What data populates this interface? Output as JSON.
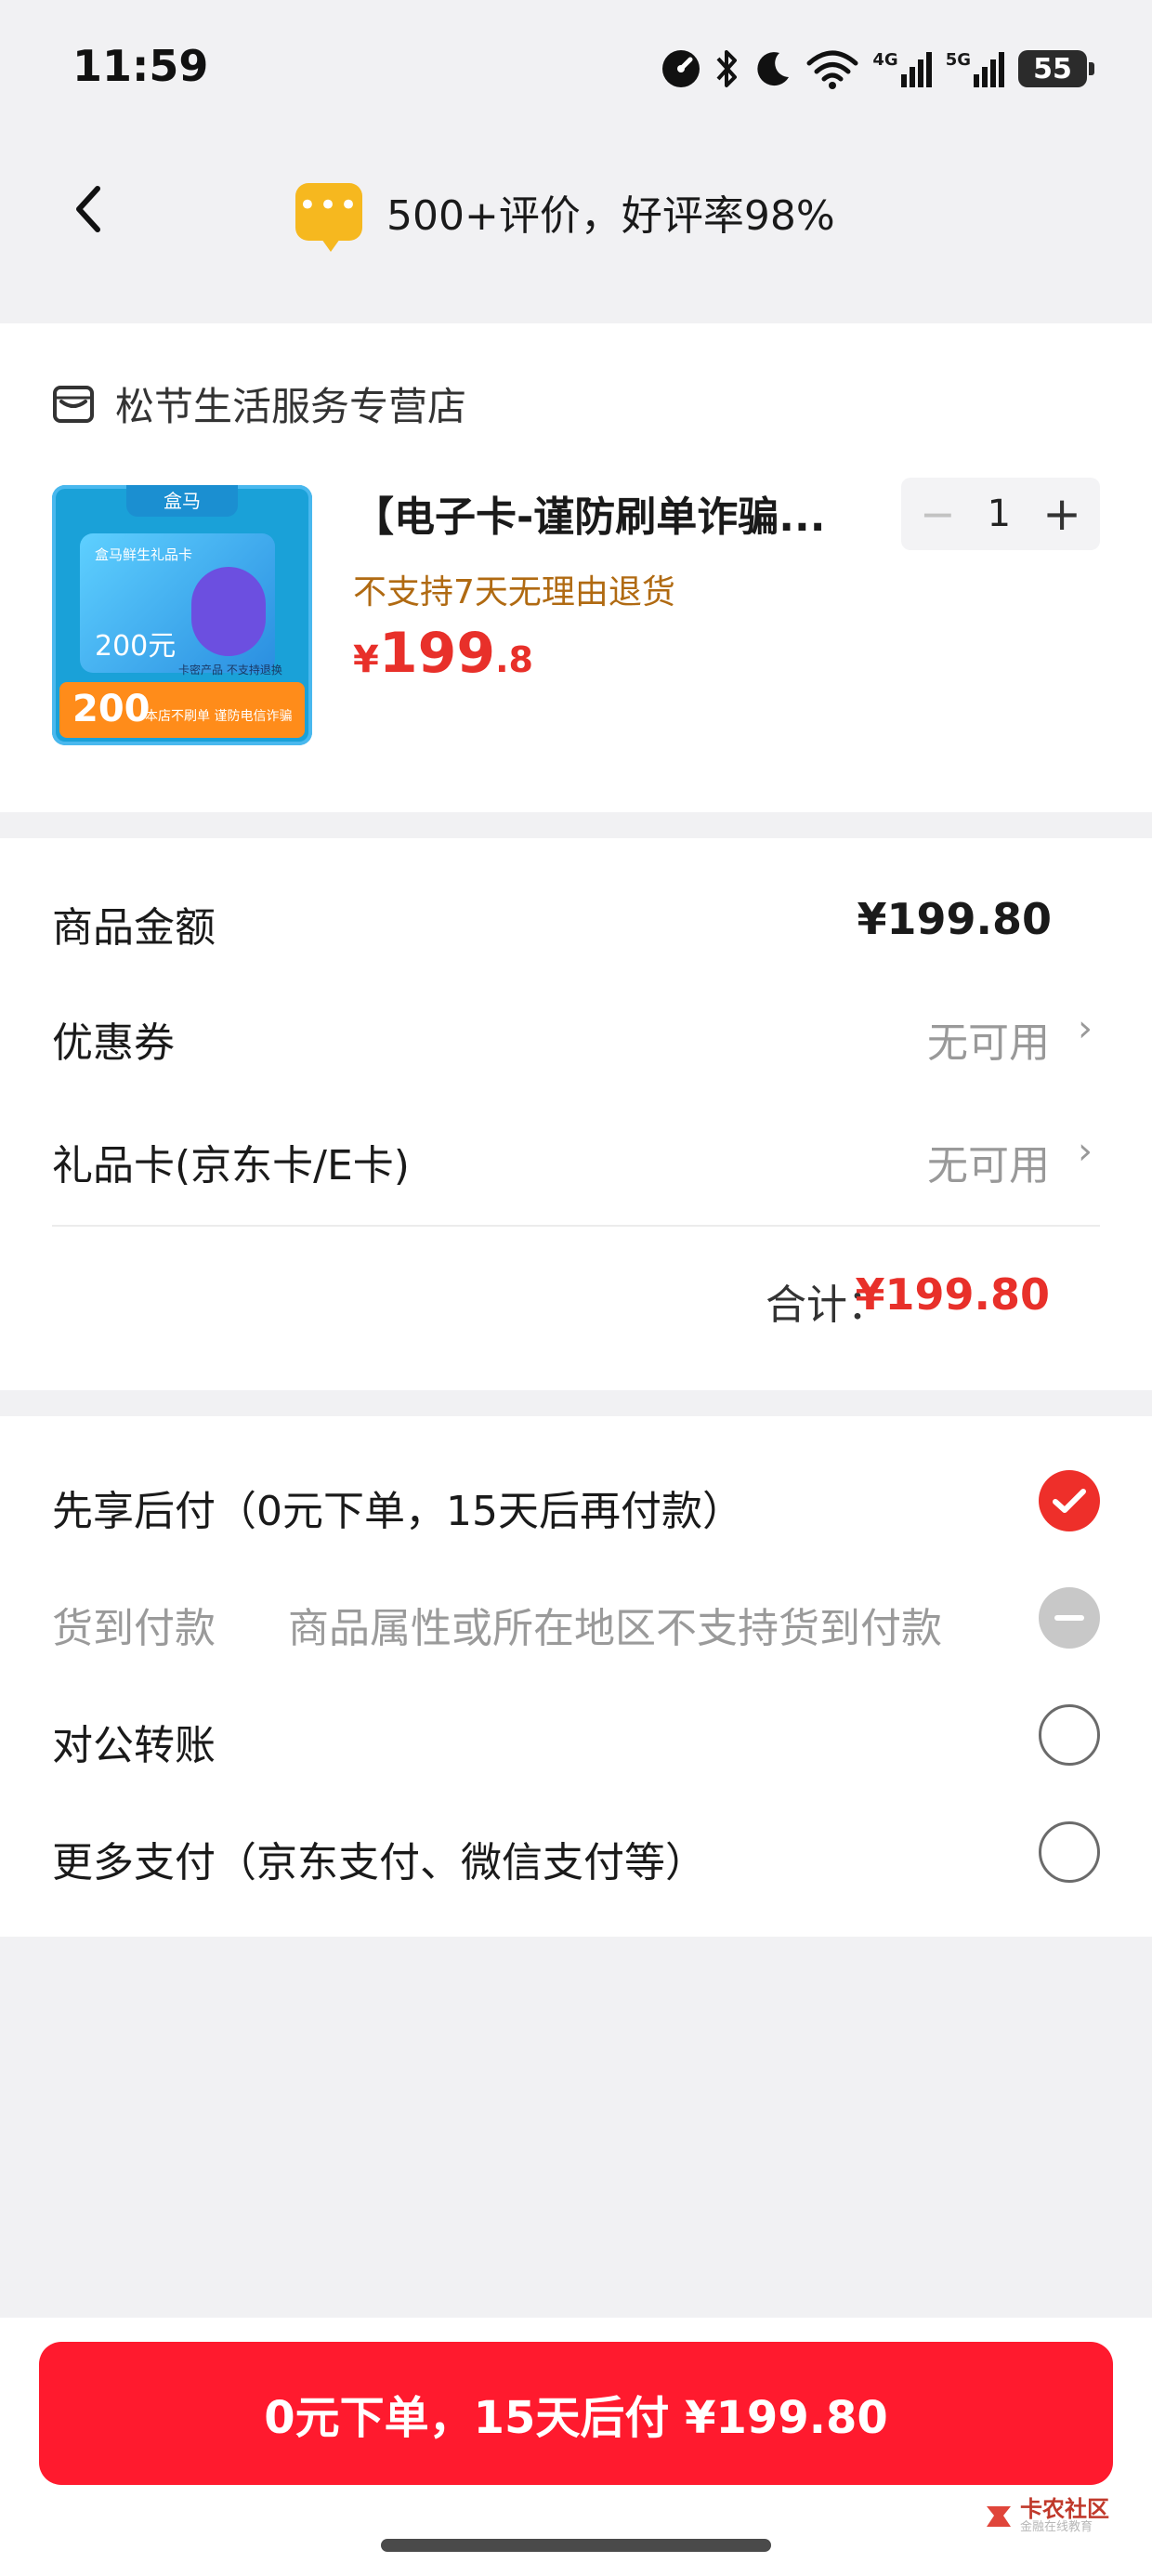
{
  "status_bar": {
    "time": "11:59",
    "network_4g": "4G",
    "network_5g": "5G",
    "battery": "55"
  },
  "header": {
    "reviews_text": "500+评价，好评率98%"
  },
  "store": {
    "name": "松节生活服务专营店"
  },
  "product": {
    "title": "【电子卡-谨防刷单诈骗...",
    "return_note": "不支持7天无理由退货",
    "price_symbol": "¥",
    "price_int": "199",
    "price_dec": ".8",
    "quantity": "1",
    "thumbnail": {
      "brand": "盒马",
      "card_title": "盒马鲜生礼品卡",
      "card_value": "200元",
      "band_number": "200",
      "band_top_text": "卡密产品 不支持退换",
      "band_text": "本店不刷单 谨防电信诈骗"
    }
  },
  "summary": {
    "goods_amount_label": "商品金额",
    "goods_amount_value": "¥199.80",
    "coupon_label": "优惠券",
    "coupon_value": "无可用",
    "giftcard_label": "礼品卡(京东卡/E卡)",
    "giftcard_value": "无可用",
    "total_label": "合计：",
    "total_value": "¥199.80"
  },
  "payment": {
    "options": [
      {
        "label": "先享后付（0元下单，15天后再付款）",
        "state": "checked"
      },
      {
        "label": "货到付款",
        "note": "商品属性或所在地区不支持货到付款",
        "state": "disabled"
      },
      {
        "label": "对公转账",
        "state": "unchecked"
      },
      {
        "label": "更多支付（京东支付、微信支付等）",
        "state": "unchecked"
      }
    ]
  },
  "submit": {
    "label": "0元下单，15天后付 ¥199.80"
  },
  "watermark": {
    "title": "卡农社区",
    "subtitle": "金融在线教育"
  },
  "colors": {
    "accent_red": "#ff1a2e",
    "price_red": "#e8302a",
    "return_note_brown": "#b06a12",
    "review_icon_yellow": "#f6b81f"
  }
}
